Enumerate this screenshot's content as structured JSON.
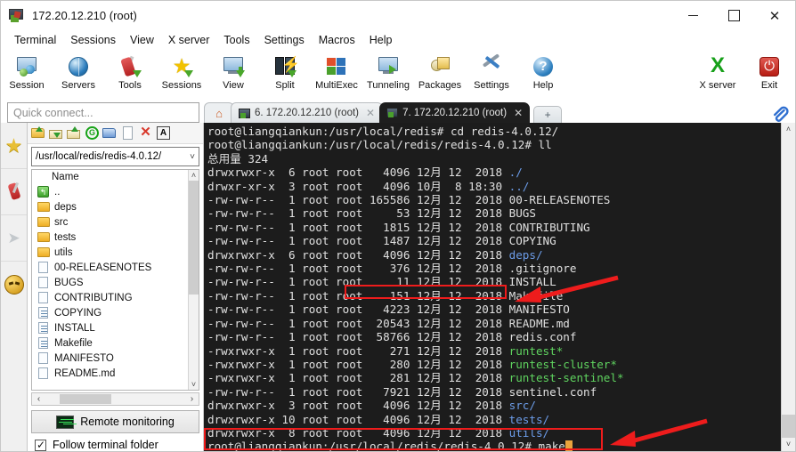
{
  "window": {
    "title": "172.20.12.210 (root)",
    "icon": "mobaxterm-session-icon",
    "minimize": "–",
    "maximize": "□",
    "close": "✕"
  },
  "menubar": {
    "items": [
      {
        "label": "Terminal"
      },
      {
        "label": "Sessions"
      },
      {
        "label": "View"
      },
      {
        "label": "X server"
      },
      {
        "label": "Tools"
      },
      {
        "label": "Settings"
      },
      {
        "label": "Macros"
      },
      {
        "label": "Help"
      }
    ]
  },
  "toolbar": {
    "items": [
      {
        "label": "Session",
        "icon": "session-icon"
      },
      {
        "label": "Servers",
        "icon": "servers-globe-icon"
      },
      {
        "label": "Tools",
        "icon": "tools-knife-icon"
      },
      {
        "label": "Sessions",
        "icon": "sessions-star-icon"
      },
      {
        "label": "View",
        "icon": "view-monitor-icon"
      },
      {
        "label": "Split",
        "icon": "split-icon"
      },
      {
        "label": "MultiExec",
        "icon": "multiexec-icon"
      },
      {
        "label": "Tunneling",
        "icon": "tunneling-icon"
      },
      {
        "label": "Packages",
        "icon": "packages-icon"
      },
      {
        "label": "Settings",
        "icon": "settings-icon"
      },
      {
        "label": "Help",
        "icon": "help-icon"
      }
    ],
    "right_items": [
      {
        "label": "X server",
        "icon": "x-server-icon"
      },
      {
        "label": "Exit",
        "icon": "exit-power-icon"
      }
    ]
  },
  "quick_connect": {
    "placeholder": "Quick connect...",
    "value": ""
  },
  "tabs": {
    "home_icon": "home-icon",
    "items": [
      {
        "label": "6. 172.20.12.210 (root)",
        "active": false,
        "close": "✕"
      },
      {
        "label": "7. 172.20.12.210 (root)",
        "active": true,
        "close": "✕"
      }
    ],
    "new_tab": "+",
    "clip_icon": "paperclip-icon"
  },
  "rail": {
    "items": [
      {
        "icon": "star-favorites-icon"
      },
      {
        "icon": "tools-knife-icon"
      },
      {
        "icon": "paper-plane-icon"
      },
      {
        "icon": "macro-smiley-icon"
      }
    ]
  },
  "sftp": {
    "tools": [
      {
        "icon": "upload-folder-icon"
      },
      {
        "icon": "download-icon"
      },
      {
        "icon": "upload-icon"
      },
      {
        "icon": "refresh-icon"
      },
      {
        "icon": "new-folder-icon"
      },
      {
        "icon": "new-file-icon"
      },
      {
        "icon": "delete-icon"
      },
      {
        "icon": "text-mode-icon"
      }
    ],
    "path": "/usr/local/redis/redis-4.0.12/",
    "path_chevron": "chevron-down-icon",
    "column_header": "Name",
    "files": [
      {
        "name": "..",
        "type": "up"
      },
      {
        "name": "deps",
        "type": "folder"
      },
      {
        "name": "src",
        "type": "folder"
      },
      {
        "name": "tests",
        "type": "folder"
      },
      {
        "name": "utils",
        "type": "folder"
      },
      {
        "name": "00-RELEASENOTES",
        "type": "file"
      },
      {
        "name": "BUGS",
        "type": "file"
      },
      {
        "name": "CONTRIBUTING",
        "type": "file"
      },
      {
        "name": "COPYING",
        "type": "textfile"
      },
      {
        "name": "INSTALL",
        "type": "textfile"
      },
      {
        "name": "Makefile",
        "type": "textfile"
      },
      {
        "name": "MANIFESTO",
        "type": "file"
      },
      {
        "name": "README.md",
        "type": "file"
      }
    ],
    "scroll_up": "˄",
    "scroll_down": "˅",
    "scroll_left": "‹",
    "scroll_right": "›",
    "remote_monitoring": "Remote monitoring",
    "remote_monitoring_icon": "monitor-graph-icon",
    "follow_terminal_folder": "Follow terminal folder",
    "follow_checked": true
  },
  "terminal": {
    "scroll_up": "˄",
    "scroll_down": "˅",
    "lines": [
      [
        {
          "t": "root@liangqiankun:/usr/local/redis# cd redis-4.0.12/",
          "c": "white"
        }
      ],
      [
        {
          "t": "root@liangqiankun:/usr/local/redis/redis-4.0.12# ll",
          "c": "white"
        }
      ],
      [
        {
          "t": "总用量 324",
          "c": "white"
        }
      ],
      [
        {
          "t": "drwxrwxr-x  6 root root   4096 12月 12  2018 ",
          "c": "white"
        },
        {
          "t": "./",
          "c": "blue"
        }
      ],
      [
        {
          "t": "drwxr-xr-x  3 root root   4096 10月  8 18:30 ",
          "c": "white"
        },
        {
          "t": "../",
          "c": "blue"
        }
      ],
      [
        {
          "t": "-rw-rw-r--  1 root root 165586 12月 12  2018 00-RELEASENOTES",
          "c": "white"
        }
      ],
      [
        {
          "t": "-rw-rw-r--  1 root root     53 12月 12  2018 BUGS",
          "c": "white"
        }
      ],
      [
        {
          "t": "-rw-rw-r--  1 root root   1815 12月 12  2018 CONTRIBUTING",
          "c": "white"
        }
      ],
      [
        {
          "t": "-rw-rw-r--  1 root root   1487 12月 12  2018 COPYING",
          "c": "white"
        }
      ],
      [
        {
          "t": "drwxrwxr-x  6 root root   4096 12月 12  2018 ",
          "c": "white"
        },
        {
          "t": "deps/",
          "c": "blue"
        }
      ],
      [
        {
          "t": "-rw-rw-r--  1 root root    376 12月 12  2018 .gitignore",
          "c": "white"
        }
      ],
      [
        {
          "t": "-rw-rw-r--  1 root root     11 12月 12  2018 INSTALL",
          "c": "white"
        }
      ],
      [
        {
          "t": "-rw-rw-r--  1 root root    151 12月 12  2018 Makefile",
          "c": "white"
        }
      ],
      [
        {
          "t": "-rw-rw-r--  1 root root   4223 12月 12  2018 MANIFESTO",
          "c": "white"
        }
      ],
      [
        {
          "t": "-rw-rw-r--  1 root root  20543 12月 12  2018 README.md",
          "c": "white"
        }
      ],
      [
        {
          "t": "-rw-rw-r--  1 root root  58766 12月 12  2018 redis.conf",
          "c": "white"
        }
      ],
      [
        {
          "t": "-rwxrwxr-x  1 root root    271 12月 12  2018 ",
          "c": "white"
        },
        {
          "t": "runtest*",
          "c": "green"
        }
      ],
      [
        {
          "t": "-rwxrwxr-x  1 root root    280 12月 12  2018 ",
          "c": "white"
        },
        {
          "t": "runtest-cluster*",
          "c": "green"
        }
      ],
      [
        {
          "t": "-rwxrwxr-x  1 root root    281 12月 12  2018 ",
          "c": "white"
        },
        {
          "t": "runtest-sentinel*",
          "c": "green"
        }
      ],
      [
        {
          "t": "-rw-rw-r--  1 root root   7921 12月 12  2018 sentinel.conf",
          "c": "white"
        }
      ],
      [
        {
          "t": "drwxrwxr-x  3 root root   4096 12月 12  2018 ",
          "c": "white"
        },
        {
          "t": "src/",
          "c": "blue"
        }
      ],
      [
        {
          "t": "drwxrwxr-x 10 root root   4096 12月 12  2018 ",
          "c": "white"
        },
        {
          "t": "tests/",
          "c": "blue"
        }
      ],
      [
        {
          "t": "drwxrwxr-x  8 root root   4096 12月 12  2018 ",
          "c": "white"
        },
        {
          "t": "utils/",
          "c": "blue"
        }
      ]
    ],
    "prompt": "root@liangqiankun:/usr/local/redis/redis-4.0.12# ",
    "command": "make",
    "cursor": "block-cursor"
  },
  "annotations": {
    "color": "#ee1c1c",
    "highlight_makefile": "Makefile",
    "highlight_command": "root@liangqiankun:/usr/local/redis/redis-4.0.12# make"
  }
}
